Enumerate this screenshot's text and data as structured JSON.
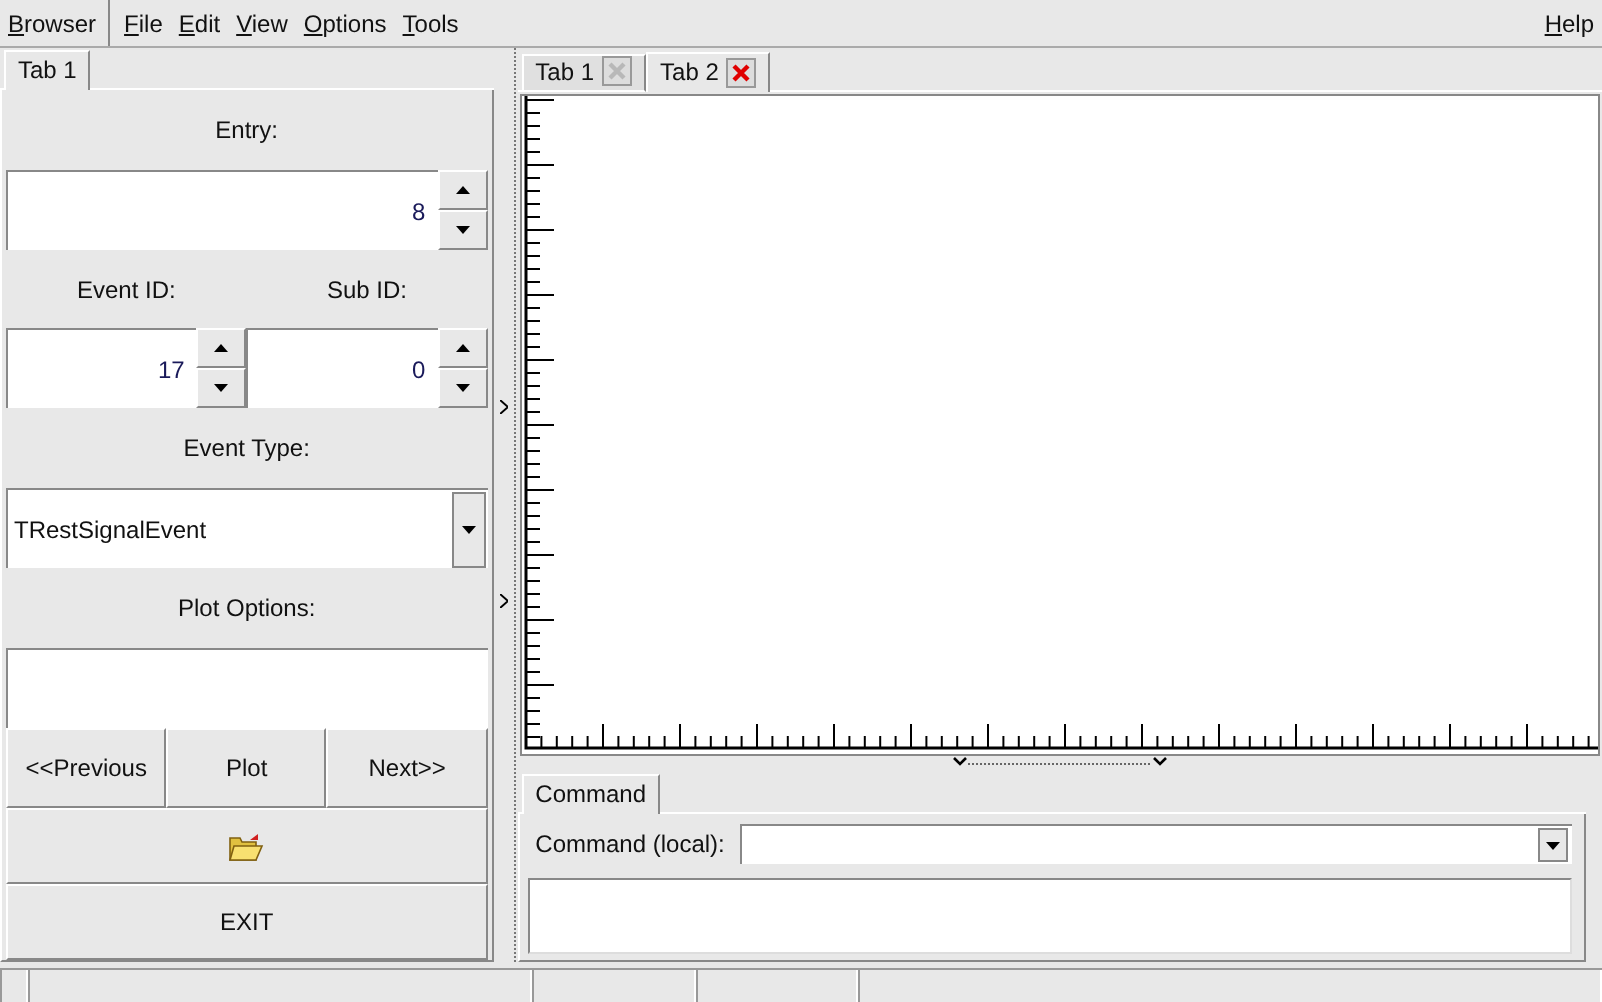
{
  "menu_bar": {
    "browser": "Browser",
    "items": [
      "File",
      "Edit",
      "View",
      "Options",
      "Tools"
    ],
    "help": "Help"
  },
  "left_panel": {
    "tabs": [
      {
        "label": "Tab 1",
        "selected": true
      }
    ],
    "entry": {
      "label": "Entry:",
      "value": "8"
    },
    "event_id": {
      "label": "Event ID:",
      "value": "17"
    },
    "sub_id": {
      "label": "Sub ID:",
      "value": "0"
    },
    "event_type": {
      "label": "Event Type:",
      "value": "TRestSignalEvent"
    },
    "plot_options": {
      "label": "Plot Options:"
    },
    "nav_buttons": [
      "<<Previous",
      "Plot",
      "Next>>"
    ],
    "exit_button": "EXIT"
  },
  "canvas_tabs": [
    {
      "label": "Tab 1",
      "selected": false
    },
    {
      "label": "Tab 2",
      "selected": true
    }
  ],
  "command": {
    "tabs": [
      {
        "label": "Command",
        "selected": true
      }
    ],
    "label": "Command (local):"
  }
}
